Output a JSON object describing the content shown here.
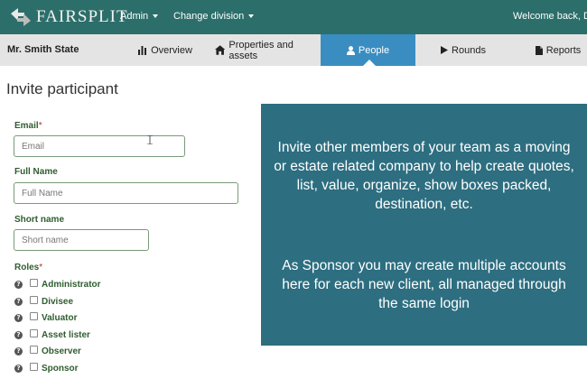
{
  "brand": {
    "name": "FAIRSPLIT"
  },
  "topbar": {
    "admin_label": "Admin",
    "change_division_label": "Change division",
    "welcome_text": "Welcome back, Da"
  },
  "subnav": {
    "client_name": "Mr. Smith State",
    "tabs": [
      {
        "label": "Overview",
        "icon": "bar-chart-icon"
      },
      {
        "label": "Properties and assets",
        "icon": "home-icon"
      },
      {
        "label": "People",
        "icon": "user-icon",
        "active": true
      },
      {
        "label": "Rounds",
        "icon": "play-icon"
      },
      {
        "label": "Reports",
        "icon": "file-icon"
      }
    ]
  },
  "page": {
    "title": "Invite participant"
  },
  "form": {
    "email": {
      "label": "Email",
      "required_mark": "*",
      "placeholder": "Email",
      "value": ""
    },
    "full_name": {
      "label": "Full Name",
      "placeholder": "Full Name",
      "value": ""
    },
    "short_name": {
      "label": "Short name",
      "placeholder": "Short name",
      "value": ""
    },
    "roles": {
      "label": "Roles",
      "required_mark": "*",
      "items": [
        {
          "label": "Administrator",
          "checked": false
        },
        {
          "label": "Divisee",
          "checked": false
        },
        {
          "label": "Valuator",
          "checked": false
        },
        {
          "label": "Asset lister",
          "checked": false
        },
        {
          "label": "Observer",
          "checked": false
        },
        {
          "label": "Sponsor",
          "checked": false
        }
      ]
    }
  },
  "info_panel": {
    "paragraph1": "Invite other members of your team as a moving or estate related company to help create quotes, list, value, organize, show boxes packed, destination, etc.",
    "paragraph2": "As Sponsor you may create multiple accounts here for each new client, all managed through the same login"
  },
  "colors": {
    "topbar": "#2c6e6a",
    "subnav": "#e4e4e4",
    "active_tab": "#3a8dc1",
    "info_panel": "#2d6e80",
    "label_green": "#2f5d2f"
  }
}
